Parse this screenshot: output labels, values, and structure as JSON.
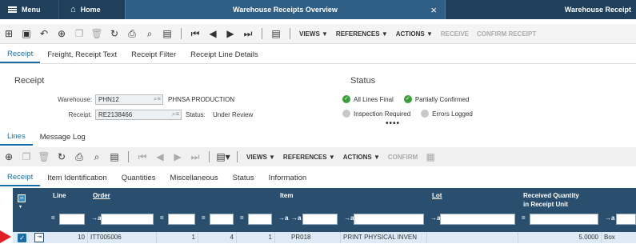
{
  "header": {
    "menu_label": "Menu",
    "home_label": "Home",
    "active_tab": "Warehouse Receipts Overview",
    "second_tab": "Warehouse Receipt",
    "close_glyph": "×"
  },
  "toolbar_top": {
    "views": "VIEWS ▼",
    "references": "REFERENCES ▼",
    "actions": "ACTIONS ▼",
    "receive": "RECEIVE",
    "confirm_receipt": "CONFIRM RECEIPT"
  },
  "tabs_top": [
    "Receipt",
    "Freight, Receipt Text",
    "Receipt Filter",
    "Receipt Line Details"
  ],
  "receipt": {
    "section": "Receipt",
    "warehouse_label": "Warehouse:",
    "warehouse_value": "PHN12",
    "warehouse_desc": "PHNSA PRODUCTION",
    "receipt_label": "Receipt:",
    "receipt_value": "RE2138466",
    "status_label": "Status:",
    "status_value": "Under Review"
  },
  "status": {
    "section": "Status",
    "all_lines_final": "All Lines Final",
    "partially_confirmed": "Partially Confirmed",
    "inspection_required": "Inspection Required",
    "errors_logged": "Errors Logged",
    "more": "••••"
  },
  "tabs_mid": [
    "Lines",
    "Message Log"
  ],
  "toolbar_lines": {
    "views": "VIEWS ▼",
    "references": "REFERENCES ▼",
    "actions": "ACTIONS ▼",
    "confirm": "CONFIRM"
  },
  "tabs_lines": [
    "Receipt",
    "Item Identification",
    "Quantities",
    "Miscellaneous",
    "Status",
    "Information"
  ],
  "table": {
    "columns": {
      "line": "Line",
      "order": "Order",
      "item": "Item",
      "lot": "Lot",
      "received_qty": "Received Quantity",
      "received_qty_2": "in Receipt Unit"
    },
    "filter_ops": {
      "eq": "=",
      "begins": "→a"
    },
    "row": {
      "line": "10",
      "order": "ITT005006",
      "c1": "1",
      "c2": "4",
      "c3": "1",
      "item": "PR018",
      "item_desc": "PRINT PHYSICAL INVEN",
      "qty": "5.0000",
      "unit": "Box"
    }
  },
  "colors": {
    "header_dark": "#1f3f5a",
    "header_tab": "#2f5f85",
    "grid_header": "#2a4e6e",
    "accent": "#1a6ea8",
    "row_selected": "#ddeaf5",
    "arrow": "#e02020"
  }
}
